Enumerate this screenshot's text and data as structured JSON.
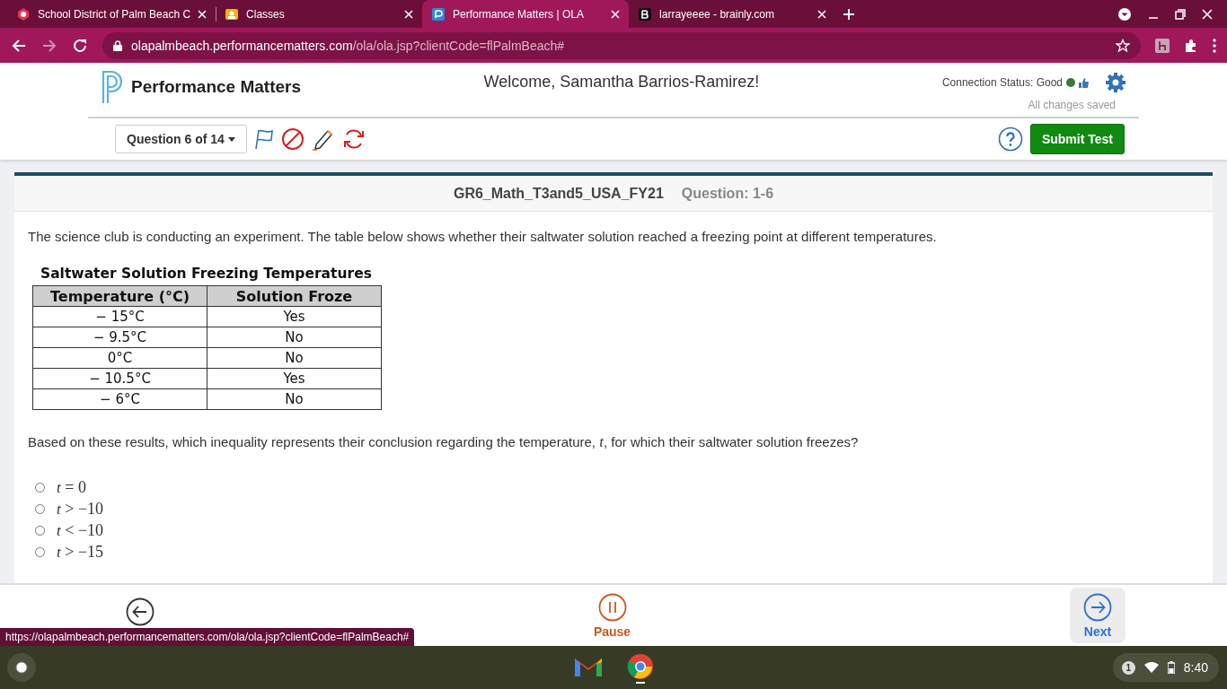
{
  "browser": {
    "tabs": [
      {
        "title": "School District of Palm Beach C",
        "selected": false
      },
      {
        "title": "Classes",
        "selected": false
      },
      {
        "title": "Performance Matters | OLA",
        "selected": true
      },
      {
        "title": "larrayeeee - brainly.com",
        "selected": false
      }
    ],
    "address": {
      "host": "olapalmbeach.performancematters.com",
      "path": "/ola/ola.jsp?clientCode=flPalmBeach#"
    }
  },
  "header": {
    "logo": "Performance Matters",
    "welcome": "Welcome, Samantha Barrios-Ramirez!",
    "connection": "Connection Status: Good",
    "saved": "All changes saved",
    "question_picker": "Question 6 of 14",
    "submit": "Submit Test"
  },
  "test": {
    "name": "GR6_Math_T3and5_USA_FY21",
    "question": "Question: 1-6",
    "intro": "The science club is conducting an experiment.  The table below shows whether their saltwater solution reached a freezing point at different temperatures.",
    "table": {
      "title": "Saltwater Solution Freezing Temperatures",
      "columns": [
        "Temperature (°C)",
        "Solution Froze"
      ],
      "rows": [
        [
          "− 15°C",
          "Yes"
        ],
        [
          "− 9.5°C",
          "No"
        ],
        [
          "0°C",
          "No"
        ],
        [
          "− 10.5°C",
          "Yes"
        ],
        [
          "− 6°C",
          "No"
        ]
      ]
    },
    "prompt": "Based on these results, which inequality represents their conclusion regarding the temperature, *t*, for which their saltwater solution freezes?",
    "choices": [
      {
        "text": "*t* = 0",
        "selected": false
      },
      {
        "text": "*t* > −10",
        "selected": false
      },
      {
        "text": "*t* < −10",
        "selected": false
      },
      {
        "text": "*t* > −15",
        "selected": false
      }
    ]
  },
  "footer": {
    "pause": "Pause",
    "next": "Next"
  },
  "status_url": "https://olapalmbeach.performancematters.com/ola/ola.jsp?clientCode=flPalmBeach#",
  "shelf": {
    "notifications": "1",
    "time": "8:40"
  }
}
